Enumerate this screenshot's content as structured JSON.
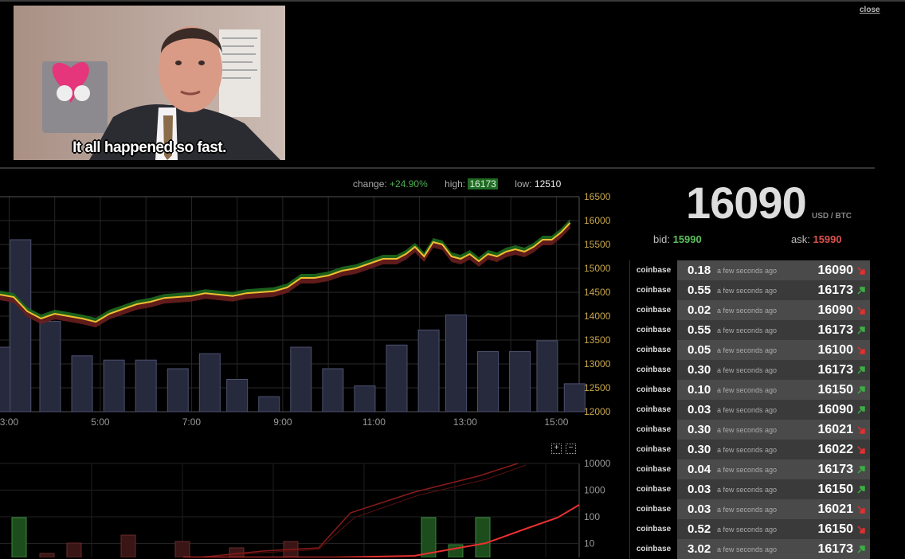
{
  "close_label": "close",
  "meme": {
    "caption": "It all happened so fast."
  },
  "stats": {
    "change_label": "change:",
    "change_value": "+24.90%",
    "high_label": "high:",
    "high_value": "16173",
    "low_label": "low:",
    "low_value": "12510"
  },
  "ticker": {
    "price": "16090",
    "unit": "USD / BTC",
    "bid_label": "bid:",
    "bid_value": "15990",
    "ask_label": "ask:",
    "ask_value": "15990"
  },
  "zoom": {
    "plus": "+",
    "minus": "−"
  },
  "trades": [
    {
      "exchange": "coinbase",
      "amount": "0.18",
      "time": "a few seconds ago",
      "price": "16090",
      "dir": "down"
    },
    {
      "exchange": "coinbase",
      "amount": "0.55",
      "time": "a few seconds ago",
      "price": "16173",
      "dir": "up"
    },
    {
      "exchange": "coinbase",
      "amount": "0.02",
      "time": "a few seconds ago",
      "price": "16090",
      "dir": "down"
    },
    {
      "exchange": "coinbase",
      "amount": "0.55",
      "time": "a few seconds ago",
      "price": "16173",
      "dir": "up"
    },
    {
      "exchange": "coinbase",
      "amount": "0.05",
      "time": "a few seconds ago",
      "price": "16100",
      "dir": "down"
    },
    {
      "exchange": "coinbase",
      "amount": "0.30",
      "time": "a few seconds ago",
      "price": "16173",
      "dir": "up"
    },
    {
      "exchange": "coinbase",
      "amount": "0.10",
      "time": "a few seconds ago",
      "price": "16150",
      "dir": "up"
    },
    {
      "exchange": "coinbase",
      "amount": "0.03",
      "time": "a few seconds ago",
      "price": "16090",
      "dir": "up"
    },
    {
      "exchange": "coinbase",
      "amount": "0.30",
      "time": "a few seconds ago",
      "price": "16021",
      "dir": "down"
    },
    {
      "exchange": "coinbase",
      "amount": "0.30",
      "time": "a few seconds ago",
      "price": "16022",
      "dir": "down"
    },
    {
      "exchange": "coinbase",
      "amount": "0.04",
      "time": "a few seconds ago",
      "price": "16173",
      "dir": "up"
    },
    {
      "exchange": "coinbase",
      "amount": "0.03",
      "time": "a few seconds ago",
      "price": "16150",
      "dir": "up"
    },
    {
      "exchange": "coinbase",
      "amount": "0.03",
      "time": "a few seconds ago",
      "price": "16021",
      "dir": "down"
    },
    {
      "exchange": "coinbase",
      "amount": "0.52",
      "time": "a few seconds ago",
      "price": "16150",
      "dir": "down"
    },
    {
      "exchange": "coinbase",
      "amount": "3.02",
      "time": "a few seconds ago",
      "price": "16173",
      "dir": "up"
    }
  ],
  "colors": {
    "up": "#3cb043",
    "down": "#e03030",
    "line": "#f0c030"
  },
  "chart_data": [
    {
      "type": "line",
      "x_ticks": [
        "3:00",
        "5:00",
        "7:00",
        "9:00",
        "11:00",
        "13:00",
        "15:00"
      ],
      "y_ticks": [
        "12000",
        "12500",
        "13000",
        "13500",
        "14000",
        "14500",
        "15000",
        "15500",
        "16000",
        "16500"
      ],
      "ylim": [
        12000,
        16500
      ],
      "x_range_hours": [
        2.8,
        15.5
      ],
      "price_x": [
        2.8,
        3.1,
        3.4,
        3.7,
        4.0,
        4.3,
        4.6,
        4.9,
        5.2,
        5.5,
        5.8,
        6.1,
        6.4,
        6.7,
        7.0,
        7.3,
        7.6,
        7.9,
        8.2,
        8.5,
        8.8,
        9.1,
        9.4,
        9.7,
        10.0,
        10.3,
        10.6,
        10.9,
        11.2,
        11.5,
        11.7,
        11.9,
        12.1,
        12.3,
        12.5,
        12.7,
        12.9,
        13.1,
        13.3,
        13.5,
        13.7,
        13.9,
        14.1,
        14.3,
        14.5,
        14.7,
        14.9,
        15.1,
        15.3
      ],
      "price_y": [
        14450,
        14400,
        14100,
        13950,
        14050,
        14000,
        13950,
        13880,
        14050,
        14150,
        14250,
        14300,
        14380,
        14400,
        14420,
        14480,
        14450,
        14420,
        14480,
        14500,
        14520,
        14600,
        14800,
        14800,
        14850,
        14950,
        15000,
        15100,
        15200,
        15200,
        15300,
        15450,
        15250,
        15550,
        15500,
        15250,
        15200,
        15300,
        15150,
        15300,
        15250,
        15350,
        15400,
        15350,
        15450,
        15600,
        15600,
        15750,
        15950
      ],
      "volume_hours": [
        3.0,
        4.0,
        5.0,
        6.0,
        7.0,
        8.0,
        9.0,
        10.0,
        11.0,
        12.0,
        13.0,
        14.0,
        15.0
      ],
      "volume_x": [
        2.9,
        3.25,
        3.9,
        4.6,
        5.3,
        6.0,
        6.7,
        7.4,
        8.0,
        8.7,
        9.4,
        10.1,
        10.8,
        11.5,
        12.2,
        12.8,
        13.5,
        14.2,
        14.8,
        15.4
      ],
      "volume_values": [
        30,
        80,
        42,
        26,
        24,
        24,
        20,
        27,
        15,
        7,
        30,
        20,
        12,
        31,
        38,
        45,
        28,
        28,
        33,
        13
      ]
    },
    {
      "type": "line",
      "y_ticks": [
        "10",
        "100",
        "1000",
        "10000"
      ],
      "log_scale": true,
      "ylim": [
        3,
        10000
      ]
    }
  ]
}
